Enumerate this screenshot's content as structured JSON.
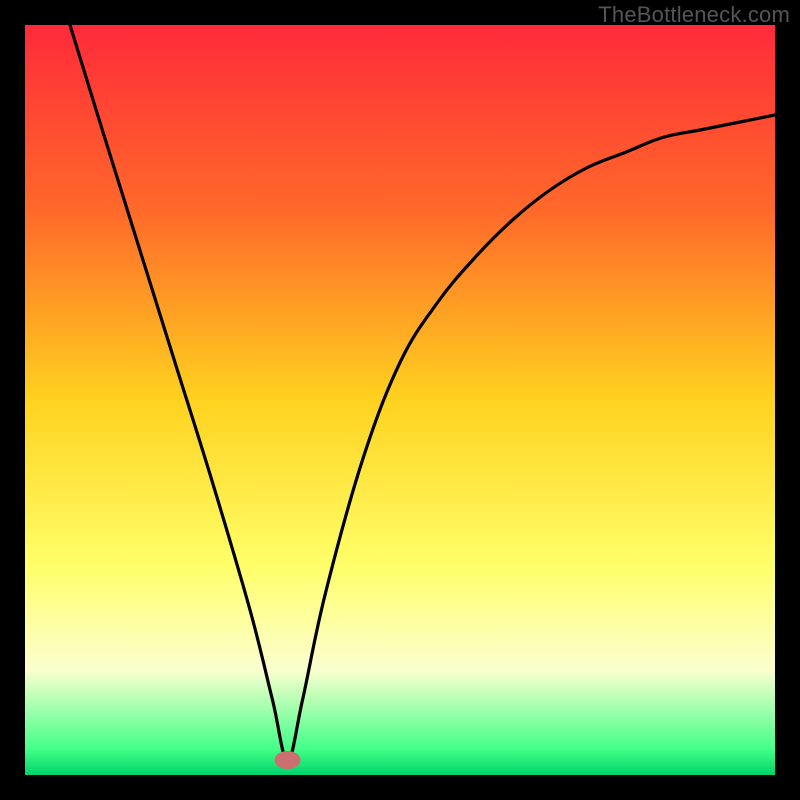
{
  "watermark": "TheBottleneck.com",
  "chart_data": {
    "type": "line",
    "title": "",
    "xlabel": "",
    "ylabel": "",
    "xlim": [
      0,
      100
    ],
    "ylim": [
      0,
      100
    ],
    "gradient_stops": [
      {
        "offset": 0.0,
        "color": "#ff2a3a"
      },
      {
        "offset": 0.25,
        "color": "#ff6a2a"
      },
      {
        "offset": 0.5,
        "color": "#ffd21f"
      },
      {
        "offset": 0.72,
        "color": "#ffff6a"
      },
      {
        "offset": 0.86,
        "color": "#fbffcf"
      },
      {
        "offset": 0.965,
        "color": "#44ff88"
      },
      {
        "offset": 1.0,
        "color": "#00d46a"
      }
    ],
    "marker": {
      "x": 35,
      "y": 2,
      "color": "#cc6f6f"
    },
    "series": [
      {
        "name": "bottleneck-curve",
        "x": [
          6,
          10,
          15,
          20,
          25,
          30,
          33,
          35,
          37,
          40,
          45,
          50,
          55,
          60,
          65,
          70,
          75,
          80,
          85,
          90,
          95,
          100
        ],
        "y": [
          100,
          87,
          71,
          55,
          39,
          22,
          10,
          2,
          10,
          24,
          42,
          55,
          63,
          69,
          74,
          78,
          81,
          83,
          85,
          86,
          87,
          88
        ]
      }
    ]
  }
}
